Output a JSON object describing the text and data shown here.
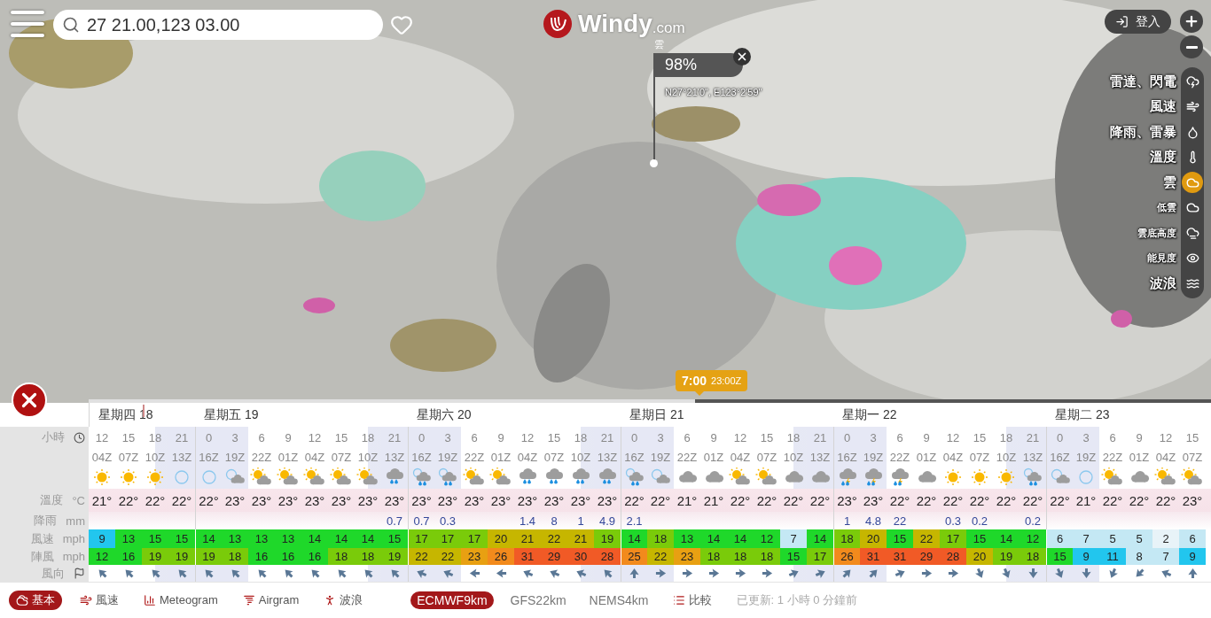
{
  "search": {
    "value": "27 21.00,123 03.00"
  },
  "logo": {
    "name": "Windy",
    "suffix": ".com"
  },
  "login": {
    "label": "登入"
  },
  "picker": {
    "layer": "雲",
    "value": "98%",
    "coords": "N27°21'0\", E123°2'59\""
  },
  "layers": [
    {
      "label": "雷達、閃電",
      "kind": "main",
      "selected": false
    },
    {
      "label": "風速",
      "kind": "main",
      "selected": false
    },
    {
      "label": "降雨、雷暴",
      "kind": "main",
      "selected": false
    },
    {
      "label": "溫度",
      "kind": "main",
      "selected": false
    },
    {
      "label": "雲",
      "kind": "main",
      "selected": true
    },
    {
      "label": "低雲",
      "kind": "sub",
      "selected": false
    },
    {
      "label": "雲底高度",
      "kind": "sub",
      "selected": false
    },
    {
      "label": "能見度",
      "kind": "sub",
      "selected": false
    },
    {
      "label": "波浪",
      "kind": "main",
      "selected": false
    }
  ],
  "timeline": {
    "time": "7:00",
    "utc": "23:00Z",
    "level": 0.54
  },
  "forecast": {
    "row_labels": [
      {
        "label": "小時"
      },
      {
        "label": "溫度",
        "unit": "°C"
      },
      {
        "label": "降雨",
        "unit": "mm"
      },
      {
        "label": "風速",
        "unit": "mph"
      },
      {
        "label": "陣風",
        "unit": "mph"
      },
      {
        "label": "風向"
      }
    ],
    "days": [
      {
        "label": "星期四 18",
        "columns": [
          {
            "hour": "12",
            "z": "04Z",
            "sky": {
              "kind": "sun"
            },
            "temp": "21°",
            "wind": "9",
            "gust": "12",
            "arrow": {
              "kind": "NW"
            },
            "night": false
          },
          {
            "hour": "15",
            "z": "07Z",
            "sky": {
              "kind": "sun"
            },
            "temp": "22°",
            "wind": "13",
            "gust": "16",
            "arrow": {
              "kind": "NW"
            },
            "night": false
          },
          {
            "hour": "18",
            "z": "10Z",
            "sky": {
              "kind": "sun"
            },
            "temp": "22°",
            "wind": "15",
            "gust": "19",
            "arrow": {
              "kind": "NW"
            },
            "night": false
          },
          {
            "hour": "21",
            "z": "13Z",
            "sky": {
              "kind": "moon"
            },
            "temp": "22°",
            "wind": "15",
            "gust": "19",
            "arrow": {
              "kind": "NW"
            },
            "night": true
          }
        ]
      },
      {
        "label": "星期五 19",
        "columns": [
          {
            "hour": "0",
            "z": "16Z",
            "sky": {
              "kind": "moon"
            },
            "temp": "22°",
            "wind": "14",
            "gust": "19",
            "arrow": {
              "kind": "NW"
            },
            "night": true
          },
          {
            "hour": "3",
            "z": "19Z",
            "sky": {
              "kind": "moon-cloud"
            },
            "temp": "23°",
            "wind": "13",
            "gust": "18",
            "arrow": {
              "kind": "NW"
            },
            "night": true
          },
          {
            "hour": "6",
            "z": "22Z",
            "sky": {
              "kind": "sun-cloud"
            },
            "temp": "23°",
            "wind": "13",
            "gust": "16",
            "arrow": {
              "kind": "NW"
            },
            "night": false
          },
          {
            "hour": "9",
            "z": "01Z",
            "sky": {
              "kind": "sun-cloud"
            },
            "temp": "23°",
            "wind": "13",
            "gust": "16",
            "arrow": {
              "kind": "NW"
            },
            "night": false
          },
          {
            "hour": "12",
            "z": "04Z",
            "sky": {
              "kind": "sun-cloud"
            },
            "temp": "23°",
            "wind": "14",
            "gust": "16",
            "arrow": {
              "kind": "NW"
            },
            "night": false
          },
          {
            "hour": "15",
            "z": "07Z",
            "sky": {
              "kind": "sun-cloud"
            },
            "temp": "23°",
            "wind": "14",
            "gust": "18",
            "arrow": {
              "kind": "NW"
            },
            "night": false
          },
          {
            "hour": "18",
            "z": "10Z",
            "sky": {
              "kind": "sun-cloud"
            },
            "temp": "23°",
            "wind": "14",
            "gust": "18",
            "arrow": {
              "kind": "NW"
            },
            "night": false
          },
          {
            "hour": "21",
            "z": "13Z",
            "sky": {
              "kind": "cloud-rain"
            },
            "temp": "23°",
            "rain": "0.7",
            "wind": "15",
            "gust": "19",
            "arrow": {
              "kind": "NW"
            },
            "night": true
          }
        ]
      },
      {
        "label": "星期六 20",
        "columns": [
          {
            "hour": "0",
            "z": "16Z",
            "sky": {
              "kind": "moon-rain"
            },
            "temp": "23°",
            "rain": "0.7",
            "wind": "17",
            "gust": "22",
            "arrow": {
              "kind": "WNW"
            },
            "night": true
          },
          {
            "hour": "3",
            "z": "19Z",
            "sky": {
              "kind": "moon-rain"
            },
            "temp": "23°",
            "rain": "0.3",
            "wind": "17",
            "gust": "22",
            "arrow": {
              "kind": "WNW"
            },
            "night": true
          },
          {
            "hour": "6",
            "z": "22Z",
            "sky": {
              "kind": "sun-cloud"
            },
            "temp": "23°",
            "wind": "17",
            "gust": "23",
            "arrow": {
              "kind": "W"
            },
            "night": false
          },
          {
            "hour": "9",
            "z": "01Z",
            "sky": {
              "kind": "sun-cloud"
            },
            "temp": "23°",
            "wind": "20",
            "gust": "26",
            "arrow": {
              "kind": "W"
            },
            "night": false
          },
          {
            "hour": "12",
            "z": "04Z",
            "sky": {
              "kind": "cloud-rain"
            },
            "temp": "23°",
            "rain": "1.4",
            "wind": "21",
            "gust": "31",
            "arrow": {
              "kind": "WNW"
            },
            "night": false
          },
          {
            "hour": "15",
            "z": "07Z",
            "sky": {
              "kind": "cloud-rain"
            },
            "temp": "23°",
            "rain": "8",
            "wind": "22",
            "gust": "29",
            "arrow": {
              "kind": "WNW"
            },
            "night": false
          },
          {
            "hour": "18",
            "z": "10Z",
            "sky": {
              "kind": "cloud-rain"
            },
            "temp": "23°",
            "rain": "1",
            "wind": "21",
            "gust": "30",
            "arrow": {
              "kind": "WNW"
            },
            "night": false
          },
          {
            "hour": "21",
            "z": "13Z",
            "sky": {
              "kind": "cloud-rain"
            },
            "temp": "23°",
            "rain": "4.9",
            "wind": "19",
            "gust": "28",
            "arrow": {
              "kind": "NW"
            },
            "night": true
          }
        ]
      },
      {
        "label": "星期日 21",
        "columns": [
          {
            "hour": "0",
            "z": "16Z",
            "sky": {
              "kind": "moon-rain"
            },
            "temp": "22°",
            "rain": "2.1",
            "wind": "14",
            "gust": "25",
            "arrow": {
              "kind": "N"
            },
            "night": true
          },
          {
            "hour": "3",
            "z": "19Z",
            "sky": {
              "kind": "moon-cloud"
            },
            "temp": "22°",
            "wind": "18",
            "gust": "22",
            "arrow": {
              "kind": "E"
            },
            "night": true
          },
          {
            "hour": "6",
            "z": "22Z",
            "sky": {
              "kind": "cloud"
            },
            "temp": "21°",
            "wind": "13",
            "gust": "23",
            "arrow": {
              "kind": "E"
            },
            "night": false
          },
          {
            "hour": "9",
            "z": "01Z",
            "sky": {
              "kind": "cloud"
            },
            "temp": "21°",
            "wind": "14",
            "gust": "18",
            "arrow": {
              "kind": "E"
            },
            "night": false
          },
          {
            "hour": "12",
            "z": "04Z",
            "sky": {
              "kind": "sun-cloud"
            },
            "temp": "22°",
            "wind": "14",
            "gust": "18",
            "arrow": {
              "kind": "E"
            },
            "night": false
          },
          {
            "hour": "15",
            "z": "07Z",
            "sky": {
              "kind": "sun-cloud"
            },
            "temp": "22°",
            "wind": "12",
            "gust": "18",
            "arrow": {
              "kind": "E"
            },
            "night": false
          },
          {
            "hour": "18",
            "z": "10Z",
            "sky": {
              "kind": "cloud"
            },
            "temp": "22°",
            "wind": "7",
            "gust": "15",
            "arrow": {
              "kind": "ENE"
            },
            "night": false
          },
          {
            "hour": "21",
            "z": "13Z",
            "sky": {
              "kind": "cloud"
            },
            "temp": "22°",
            "wind": "14",
            "gust": "17",
            "arrow": {
              "kind": "ENE"
            },
            "night": true
          }
        ]
      },
      {
        "label": "星期一 22",
        "columns": [
          {
            "hour": "0",
            "z": "16Z",
            "sky": {
              "kind": "thunder-rain"
            },
            "temp": "23°",
            "rain": "1",
            "wind": "18",
            "gust": "26",
            "arrow": {
              "kind": "NE"
            },
            "night": true
          },
          {
            "hour": "3",
            "z": "19Z",
            "sky": {
              "kind": "thunder-rain"
            },
            "temp": "23°",
            "rain": "4.8",
            "wind": "20",
            "gust": "31",
            "arrow": {
              "kind": "NE"
            },
            "night": true
          },
          {
            "hour": "6",
            "z": "22Z",
            "sky": {
              "kind": "thunder-rain"
            },
            "temp": "22°",
            "rain": "22",
            "wind": "15",
            "gust": "31",
            "arrow": {
              "kind": "ENE"
            },
            "night": false
          },
          {
            "hour": "9",
            "z": "01Z",
            "sky": {
              "kind": "cloud"
            },
            "temp": "22°",
            "wind": "22",
            "gust": "29",
            "arrow": {
              "kind": "E"
            },
            "night": false
          },
          {
            "hour": "12",
            "z": "04Z",
            "sky": {
              "kind": "sun"
            },
            "temp": "22°",
            "rain": "0.3",
            "wind": "17",
            "gust": "28",
            "arrow": {
              "kind": "E"
            },
            "night": false
          },
          {
            "hour": "15",
            "z": "07Z",
            "sky": {
              "kind": "sun"
            },
            "temp": "22°",
            "rain": "0.2",
            "wind": "15",
            "gust": "20",
            "arrow": {
              "kind": "SSE"
            },
            "night": false
          },
          {
            "hour": "18",
            "z": "10Z",
            "sky": {
              "kind": "sun"
            },
            "temp": "22°",
            "wind": "14",
            "gust": "19",
            "arrow": {
              "kind": "SSE"
            },
            "night": false
          },
          {
            "hour": "21",
            "z": "13Z",
            "sky": {
              "kind": "moon-rain"
            },
            "temp": "22°",
            "rain": "0.2",
            "wind": "12",
            "gust": "18",
            "arrow": {
              "kind": "S"
            },
            "night": true
          }
        ]
      },
      {
        "label": "星期二 23",
        "columns": [
          {
            "hour": "0",
            "z": "16Z",
            "sky": {
              "kind": "moon-cloud"
            },
            "temp": "22°",
            "wind": "6",
            "gust": "15",
            "arrow": {
              "kind": "SSE"
            },
            "night": true
          },
          {
            "hour": "3",
            "z": "19Z",
            "sky": {
              "kind": "moon"
            },
            "temp": "21°",
            "wind": "7",
            "gust": "9",
            "arrow": {
              "kind": "S"
            },
            "night": true
          },
          {
            "hour": "6",
            "z": "22Z",
            "sky": {
              "kind": "sun-cloud"
            },
            "temp": "22°",
            "wind": "5",
            "gust": "11",
            "arrow": {
              "kind": "SSW"
            },
            "night": false
          },
          {
            "hour": "9",
            "z": "01Z",
            "sky": {
              "kind": "cloud"
            },
            "temp": "22°",
            "wind": "5",
            "gust": "8",
            "arrow": {
              "kind": "SW"
            },
            "night": false
          },
          {
            "hour": "12",
            "z": "04Z",
            "sky": {
              "kind": "sun-cloud"
            },
            "temp": "22°",
            "wind": "2",
            "gust": "7",
            "arrow": {
              "kind": "WNW"
            },
            "night": false
          },
          {
            "hour": "15",
            "z": "07Z",
            "sky": {
              "kind": "sun-cloud"
            },
            "temp": "23°",
            "wind": "6",
            "gust": "9",
            "arrow": {
              "kind": "N"
            },
            "night": false
          }
        ]
      }
    ]
  },
  "bottom_tabs": [
    {
      "label": "基本",
      "selected": true
    },
    {
      "label": "風速",
      "selected": false
    },
    {
      "label": "Meteogram",
      "selected": false
    },
    {
      "label": "Airgram",
      "selected": false
    },
    {
      "label": "波浪",
      "selected": false
    }
  ],
  "models": [
    {
      "label": "ECMWF9km",
      "selected": true
    },
    {
      "label": "GFS22km",
      "selected": false
    },
    {
      "label": "NEMS4km",
      "selected": false
    }
  ],
  "compare": {
    "label": "比較"
  },
  "updated": "已更新: 1 小時 0 分鐘前"
}
